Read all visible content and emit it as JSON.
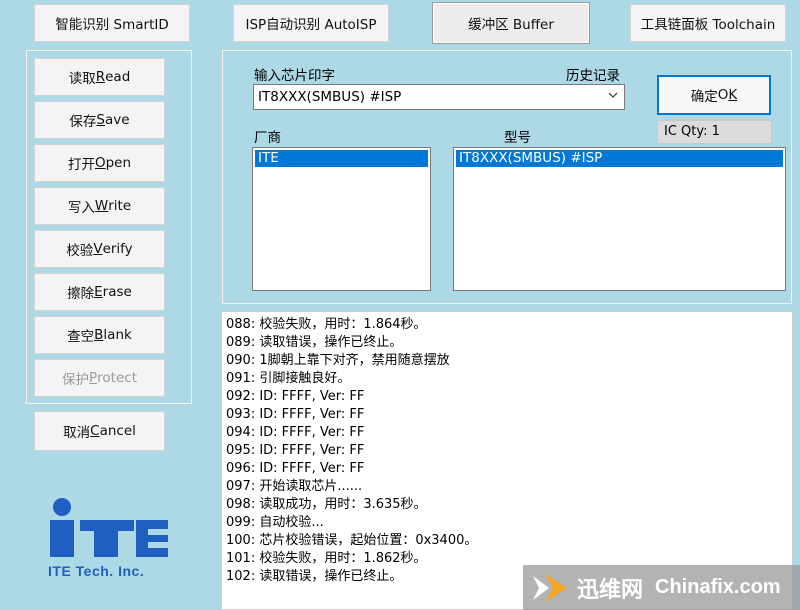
{
  "top_buttons": {
    "smartid": "智能识别 SmartID",
    "autoisp": "ISP自动识别 AutoISP",
    "buffer": "缓冲区 Buffer",
    "toolchain": "工具链面板 Toolchain"
  },
  "side_buttons": {
    "read": {
      "cn": "读取 ",
      "key": "R",
      "rest": "ead"
    },
    "save": {
      "cn": "保存 ",
      "key": "S",
      "rest": "ave"
    },
    "open": {
      "cn": "打开 ",
      "key": "O",
      "rest": "pen"
    },
    "write": {
      "cn": "写入 ",
      "key": "W",
      "rest": "rite"
    },
    "verify": {
      "cn": "校验 ",
      "key": "V",
      "rest": "erify"
    },
    "erase": {
      "cn": "擦除 ",
      "key": "E",
      "rest": "rase"
    },
    "blank": {
      "cn": "查空 ",
      "key": "B",
      "rest": "lank"
    },
    "protect": {
      "cn": "保护 ",
      "key": "P",
      "rest": "rotect"
    },
    "cancel": {
      "cn": "取消 ",
      "key": "C",
      "rest": "ancel"
    }
  },
  "chip": {
    "input_label": "输入芯片印字",
    "history_label": "历史记录",
    "input_value": "IT8XXX(SMBUS) #ISP",
    "ok": {
      "cn": "确定 ",
      "pre": "O",
      "key": "K"
    },
    "ic_qty": "IC Qty: 1",
    "vendor_label": "厂商",
    "model_label": "型号",
    "vendor_selected": "ITE",
    "model_selected": "IT8XXX(SMBUS) #ISP"
  },
  "log_lines": [
    "088: 校验失败，用时：1.864秒。",
    "089: 读取错误，操作已终止。",
    "090: 1脚朝上靠下对齐，禁用随意摆放",
    "091: 引脚接触良好。",
    "092: ID: FFFF, Ver: FF",
    "093: ID: FFFF, Ver: FF",
    "094: ID: FFFF, Ver: FF",
    "095: ID: FFFF, Ver: FF",
    "096: ID: FFFF, Ver: FF",
    "097: 开始读取芯片......",
    "098: 读取成功，用时：3.635秒。",
    "099: 自动校验...",
    "100: 芯片校验错误，起始位置：0x3400。",
    "101: 校验失败，用时：1.862秒。",
    "102: 读取错误，操作已终止。"
  ],
  "logo": {
    "brand": "iTE",
    "tagline": "ITE Tech. Inc.",
    "color": "#1f5fbf"
  },
  "watermark": {
    "cn": "迅维网",
    "en": "Chinafix.com"
  }
}
